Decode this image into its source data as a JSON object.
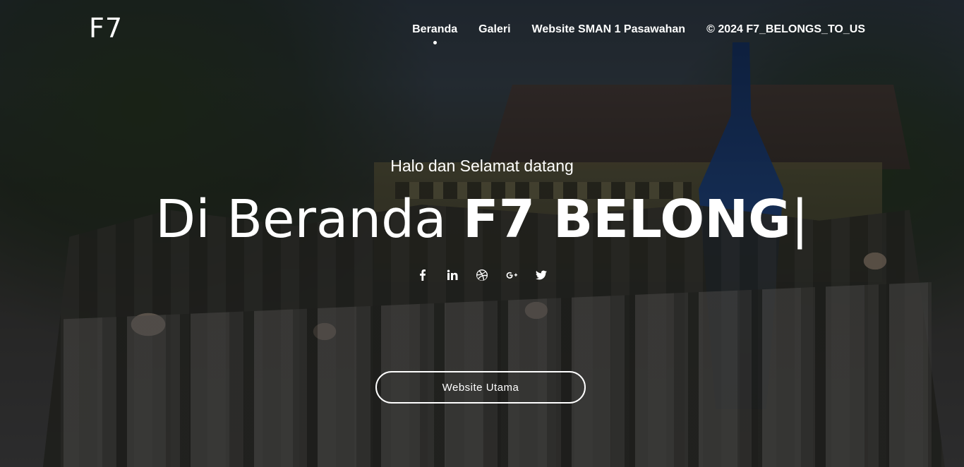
{
  "brand": {
    "logo_text": "F7"
  },
  "nav": {
    "items": [
      {
        "label": "Beranda",
        "active": true
      },
      {
        "label": "Galeri",
        "active": false
      },
      {
        "label": "Website SMAN 1 Pasawahan",
        "active": false
      },
      {
        "label": "© 2024 F7_BELONGS_TO_US",
        "active": false
      }
    ]
  },
  "hero": {
    "subtitle": "Halo dan Selamat datang",
    "headline_prefix": "Di Beranda ",
    "headline_typed": "F7 BELONG",
    "caret": "|",
    "cta_label": "Website Utama"
  },
  "social": {
    "icons": [
      "facebook-icon",
      "linkedin-icon",
      "dribbble-icon",
      "google-plus-icon",
      "twitter-icon"
    ]
  },
  "colors": {
    "text": "#ffffff",
    "overlay": "rgba(0,0,0,0.5)"
  }
}
